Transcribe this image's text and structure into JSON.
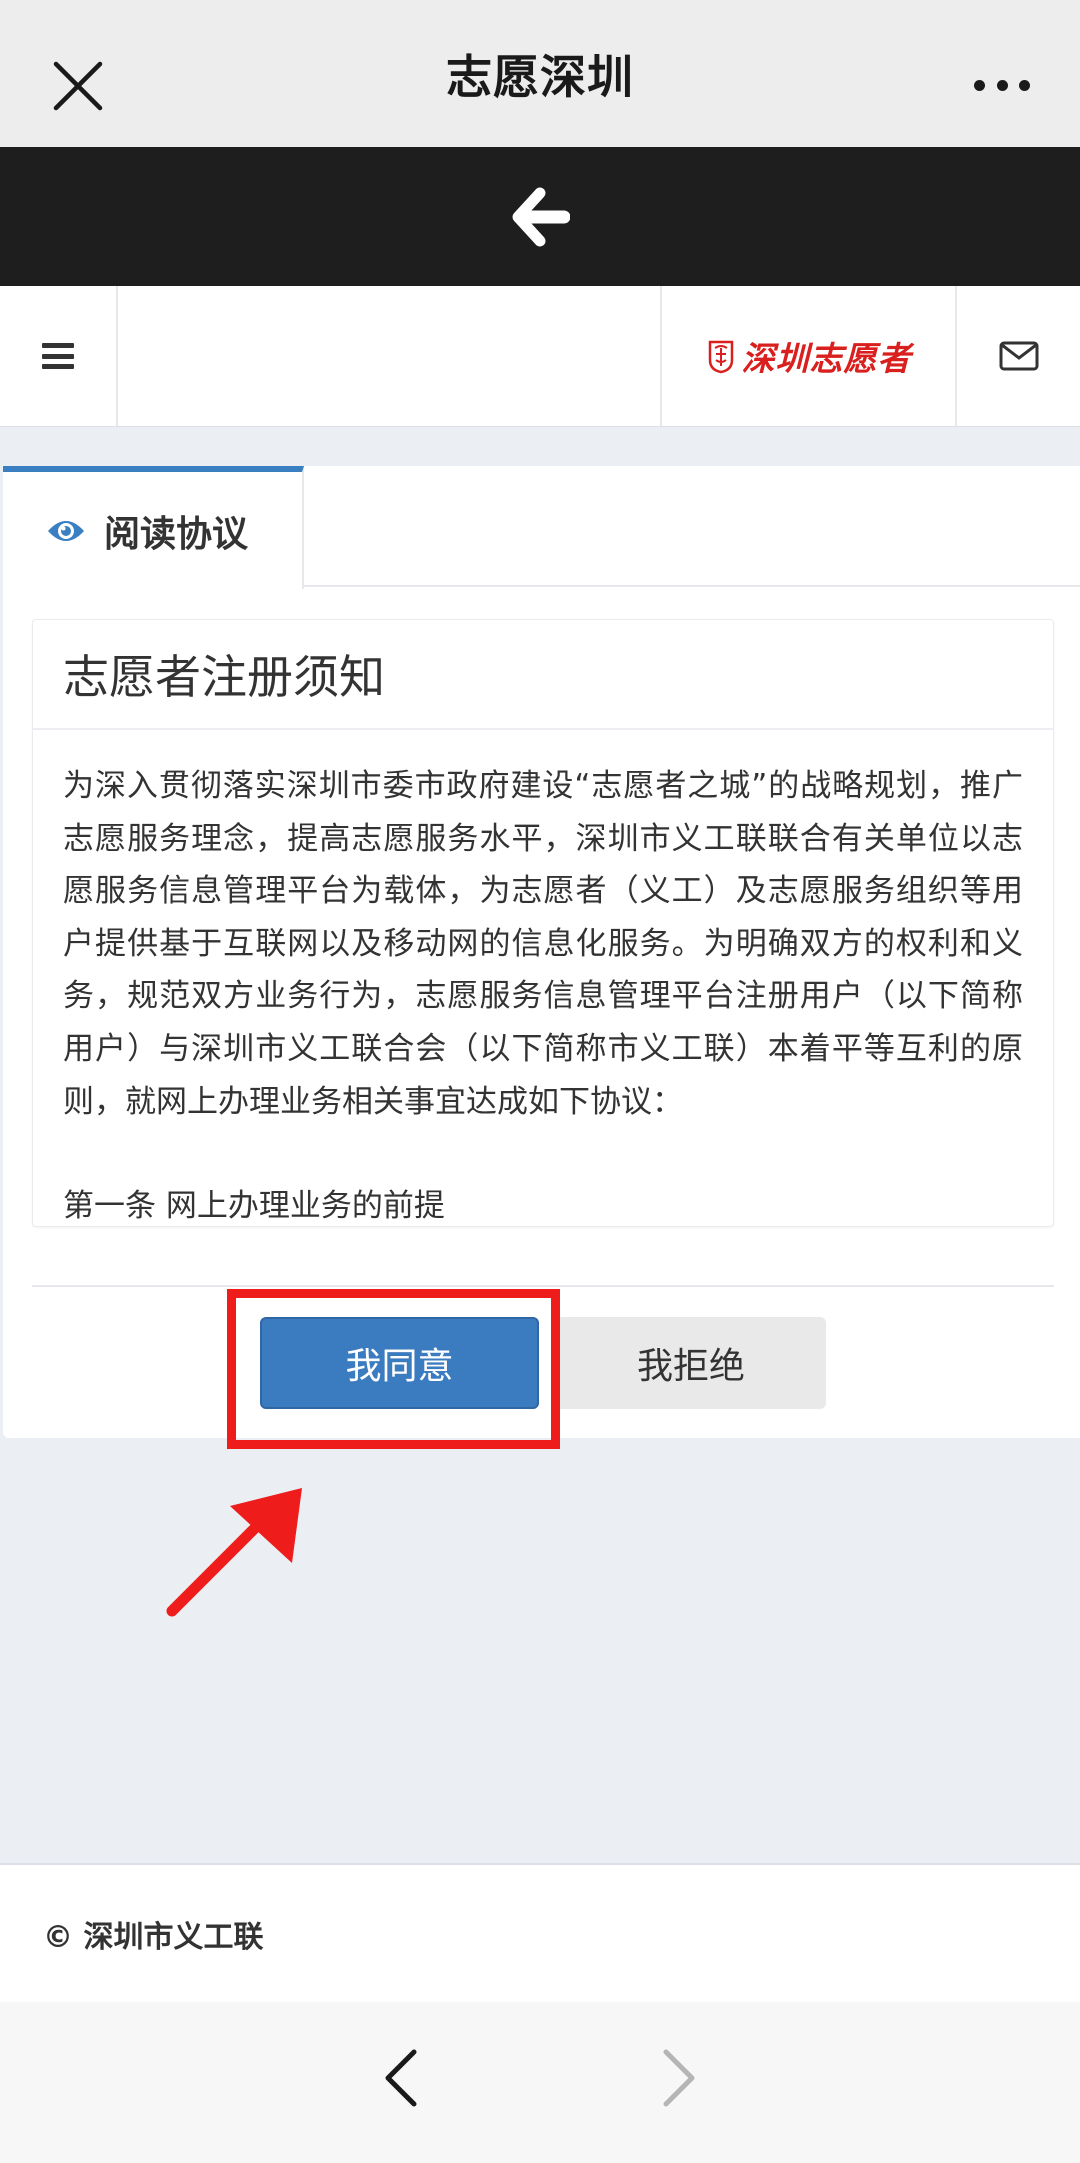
{
  "header": {
    "title": "志愿深圳"
  },
  "brand": {
    "logo_text": "深圳志愿者",
    "logo_color": "#d9201e"
  },
  "tabs": [
    {
      "label": "阅读协议",
      "active": true
    }
  ],
  "notice": {
    "title": "志愿者注册须知",
    "paragraph": "为深入贯彻落实深圳市委市政府建设“志愿者之城”的战略规划，推广志愿服务理念，提高志愿服务水平，深圳市义工联联合有关单位以志愿服务信息管理平台为载体，为志愿者（义工）及志愿服务组织等用户提供基于互联网以及移动网的信息化服务。为明确双方的权利和义务，规范双方业务行为，志愿服务信息管理平台注册用户（以下简称用户）与深圳市义工联合会（以下简称市义工联）本着平等互利的原则，就网上办理业务相关事宜达成如下协议：",
    "section_1": "第一条 网上办理业务的前提"
  },
  "actions": {
    "agree_label": "我同意",
    "refuse_label": "我拒绝"
  },
  "footer": {
    "copyright": "© 深圳市义工联"
  },
  "colors": {
    "accent": "#3b7bbf",
    "highlight": "#ef1c1c",
    "dark_bar": "#1e1e1e"
  }
}
